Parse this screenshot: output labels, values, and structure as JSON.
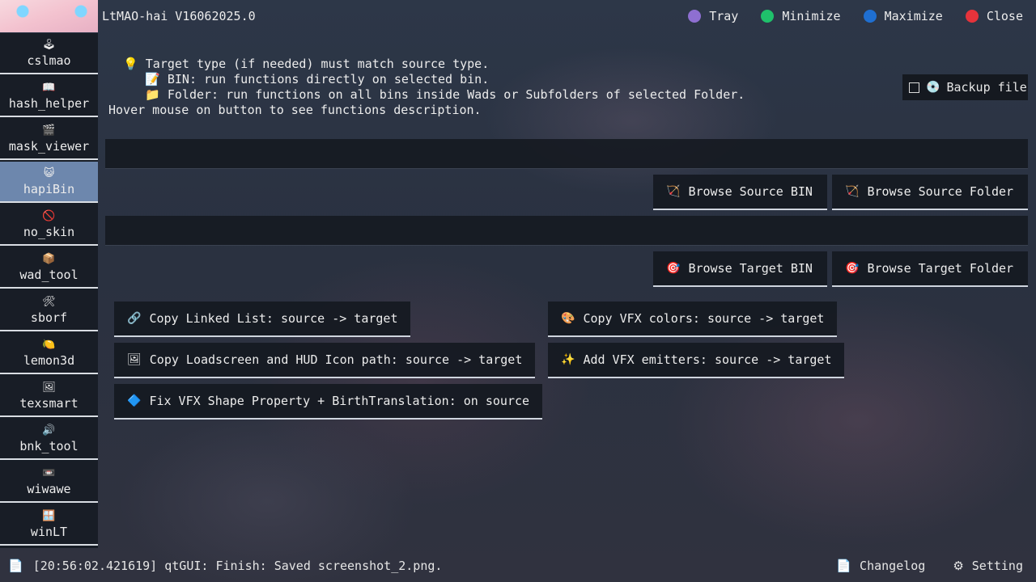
{
  "app": {
    "title": "LtMAO-hai V16062025.0"
  },
  "window_controls": [
    {
      "label": "Tray",
      "color": "#8e6fd1"
    },
    {
      "label": "Minimize",
      "color": "#1fc16b"
    },
    {
      "label": "Maximize",
      "color": "#1f6fd1"
    },
    {
      "label": "Close",
      "color": "#e5333b"
    }
  ],
  "sidebar": {
    "active": "hapiBin",
    "items": [
      {
        "label": "cslmao",
        "icon": "🕹"
      },
      {
        "label": "hash_helper",
        "icon": "📖"
      },
      {
        "label": "mask_viewer",
        "icon": "🎬"
      },
      {
        "label": "hapiBin",
        "icon": "😺"
      },
      {
        "label": "no_skin",
        "icon": "🚫"
      },
      {
        "label": "wad_tool",
        "icon": "📦"
      },
      {
        "label": "sborf",
        "icon": "🛠"
      },
      {
        "label": "lemon3d",
        "icon": "🍋"
      },
      {
        "label": "texsmart",
        "icon": "🖼"
      },
      {
        "label": "bnk_tool",
        "icon": "🔊"
      },
      {
        "label": "wiwawe",
        "icon": "📼"
      },
      {
        "label": "winLT",
        "icon": "🪟"
      }
    ]
  },
  "info": {
    "line1_icon": "💡",
    "line1": "Target type (if needed) must match source type.",
    "line2_icon": "📝",
    "line2": "BIN: run functions directly on selected bin.",
    "line3_icon": "📁",
    "line3": "Folder: run functions on all bins inside Wads or Subfolders of selected Folder.",
    "line4": "Hover mouse on button to see functions description."
  },
  "backup": {
    "label": "Backup file",
    "checked": false,
    "icon": "💿"
  },
  "source": {
    "path": "",
    "browse_bin": "Browse Source BIN",
    "browse_folder": "Browse Source Folder",
    "icon": "🏹"
  },
  "target": {
    "path": "",
    "browse_bin": "Browse Target BIN",
    "browse_folder": "Browse Target Folder",
    "icon": "🎯"
  },
  "actions": [
    {
      "label": "Copy Linked List: source -> target",
      "icon": "🔗"
    },
    {
      "label": "Copy VFX colors: source -> target",
      "icon": "🎨"
    },
    {
      "label": "Copy Loadscreen and HUD Icon path: source -> target",
      "icon": "🖼"
    },
    {
      "label": "Add VFX emitters: source -> target",
      "icon": "✨"
    },
    {
      "label": "Fix VFX Shape Property + BirthTranslation: on source",
      "icon": "🔷"
    }
  ],
  "status": {
    "icon": "📄",
    "log": "[20:56:02.421619] qtGUI: Finish: Saved screenshot_2.png.",
    "changelog_icon": "📄",
    "changelog": "Changelog",
    "setting_icon": "⚙",
    "setting": "Setting"
  }
}
